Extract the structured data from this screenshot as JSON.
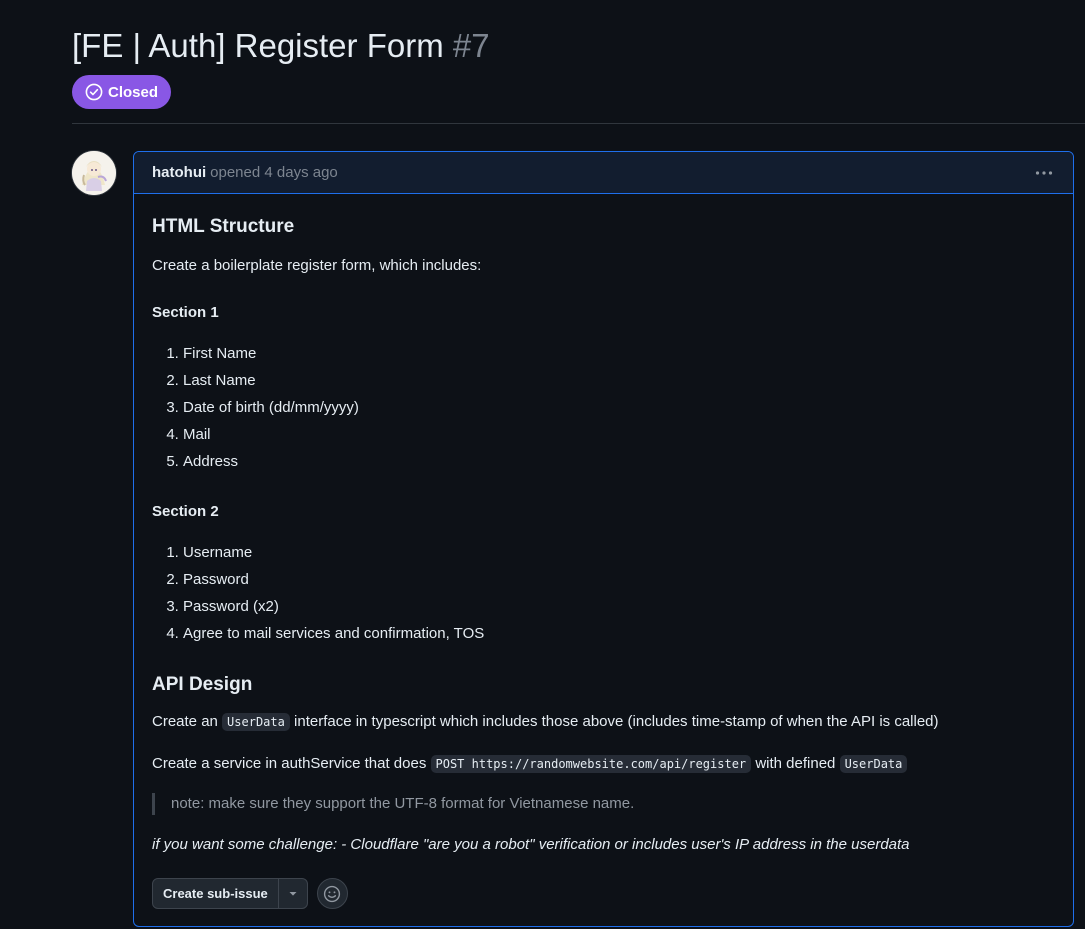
{
  "issue": {
    "title": "[FE | Auth] Register Form",
    "number": "#7",
    "state": "Closed",
    "state_color": "#8957e5"
  },
  "comment": {
    "author": "hatohui",
    "opened_text": "opened 4 days ago",
    "avatar_icon": "avatar-illustration"
  },
  "body": {
    "heading1": "HTML Structure",
    "intro": "Create a boilerplate register form, which includes:",
    "section1_title": "Section 1",
    "section1_items": [
      "First Name",
      "Last Name",
      "Date of birth (dd/mm/yyyy)",
      "Mail",
      "Address"
    ],
    "section2_title": "Section 2",
    "section2_items": [
      "Username",
      "Password",
      "Password (x2)",
      "Agree to mail services and confirmation, TOS"
    ],
    "heading2": "API Design",
    "interface_prefix": "Create an",
    "interface_code": "UserData",
    "interface_suffix": "interface in typescript which includes those above (includes time-stamp of when the API is called)",
    "service_prefix": "Create a service in authService that does",
    "service_code": "POST https://randomwebsite.com/api/register",
    "service_middle": "with defined",
    "service_code2": "UserData",
    "note": "note: make sure they support the UTF-8 format for Vietnamese name.",
    "challenge": "if you want some challenge: - Cloudflare \"are you a robot\" verification or includes user's IP address in the userdata"
  },
  "actions": {
    "create_subissue": "Create sub-issue",
    "dropdown_icon": "triangle-down-icon",
    "reaction_icon": "smiley-icon"
  }
}
